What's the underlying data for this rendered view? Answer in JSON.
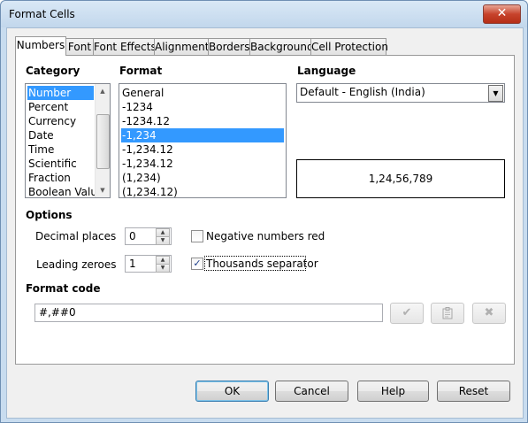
{
  "window": {
    "title": "Format Cells",
    "close_label": "✕"
  },
  "tabs": [
    "Numbers",
    "Font",
    "Font Effects",
    "Alignment",
    "Borders",
    "Background",
    "Cell Protection"
  ],
  "category": {
    "label": "Category",
    "items": [
      "Number",
      "Percent",
      "Currency",
      "Date",
      "Time",
      "Scientific",
      "Fraction",
      "Boolean Value"
    ],
    "selected": "Number"
  },
  "format": {
    "label": "Format",
    "items": [
      "General",
      "-1234",
      "-1234.12",
      "-1,234",
      "-1,234.12",
      "-1,234.12",
      "(1,234)",
      "(1,234.12)"
    ],
    "selected": "-1,234"
  },
  "language": {
    "label": "Language",
    "value": "Default - English (India)"
  },
  "preview": {
    "value": "1,24,56,789"
  },
  "options": {
    "label": "Options",
    "decimal_places": {
      "label": "Decimal places",
      "value": "0"
    },
    "leading_zeroes": {
      "label": "Leading zeroes",
      "value": "1"
    },
    "negative_red": {
      "label": "Negative numbers red",
      "checked": false
    },
    "thousands_sep": {
      "label": "Thousands separator",
      "checked": true
    }
  },
  "format_code": {
    "label": "Format code",
    "value": "#,##0"
  },
  "buttons": {
    "ok": "OK",
    "cancel": "Cancel",
    "help": "Help",
    "reset": "Reset"
  },
  "icons": {
    "accept": "checkmark-icon",
    "comment": "clipboard-icon",
    "delete": "x-icon"
  }
}
